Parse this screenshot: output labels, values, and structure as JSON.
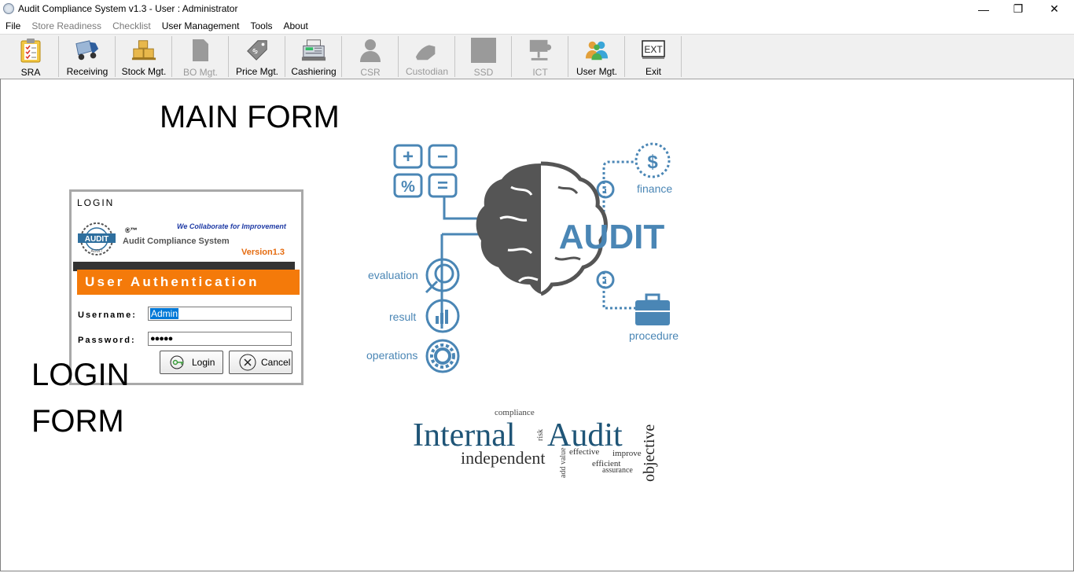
{
  "window": {
    "title": "Audit Compliance System v1.3  -  User : Administrator",
    "controls": {
      "minimize": "—",
      "restore": "❐",
      "close": "✕"
    }
  },
  "menu": [
    {
      "label": "File",
      "enabled": true
    },
    {
      "label": "Store Readiness",
      "enabled": false
    },
    {
      "label": "Checklist",
      "enabled": false
    },
    {
      "label": "User Management",
      "enabled": true
    },
    {
      "label": "Tools",
      "enabled": true
    },
    {
      "label": "About",
      "enabled": true
    }
  ],
  "toolbar": [
    {
      "label": "SRA",
      "icon": "clipboard-icon",
      "enabled": true
    },
    {
      "label": "Receiving",
      "icon": "truck-icon",
      "enabled": true
    },
    {
      "label": "Stock Mgt.",
      "icon": "boxes-icon",
      "enabled": true
    },
    {
      "label": "BO Mgt.",
      "icon": "document-icon",
      "enabled": false
    },
    {
      "label": "Price Mgt.",
      "icon": "price-tag-icon",
      "enabled": true
    },
    {
      "label": "Cashiering",
      "icon": "cash-register-icon",
      "enabled": true
    },
    {
      "label": "CSR",
      "icon": "person-icon",
      "enabled": false
    },
    {
      "label": "Custodian",
      "icon": "hand-icon",
      "enabled": false
    },
    {
      "label": "SSD",
      "icon": "square-icon",
      "enabled": false
    },
    {
      "label": "ICT",
      "icon": "network-icon",
      "enabled": false
    },
    {
      "label": "User Mgt.",
      "icon": "users-icon",
      "enabled": true
    },
    {
      "label": "Exit",
      "icon": "exit-icon",
      "enabled": true
    }
  ],
  "annotations": {
    "main_form": "MAIN FORM",
    "login_form_line1": "LOGIN",
    "login_form_line2": "FORM"
  },
  "login": {
    "caption": "LOGIN",
    "logo_text_top": "AUDIT",
    "logo_text_bottom": "AUDIT",
    "tagline": "We Collaborate for Improvement",
    "registered": "®™",
    "system_name": "Audit Compliance System",
    "version": "Version1.3",
    "banner": "User Authentication",
    "username_label": "Username:",
    "username_value": "Admin",
    "password_label": "Password:",
    "password_value": "●●●●●",
    "login_button": "Login",
    "cancel_button": "Cancel"
  },
  "graphic": {
    "audit_word": "AUDIT",
    "labels": {
      "finance": "finance",
      "procedure": "procedure",
      "evaluation": "evaluation",
      "result": "result",
      "operations": "operations",
      "dollar": "$",
      "info": "i",
      "plus": "+",
      "minus": "−",
      "percent": "%",
      "equals": "="
    },
    "color": "#4a86b5"
  },
  "wordcloud": {
    "internal": "Internal",
    "audit": "Audit",
    "independent": "independent",
    "objective": "objective",
    "compliance": "compliance",
    "risk": "risk",
    "add_value": "add value",
    "effective": "effective",
    "improve": "improve",
    "efficient": "efficient",
    "assurance": "assurance"
  }
}
